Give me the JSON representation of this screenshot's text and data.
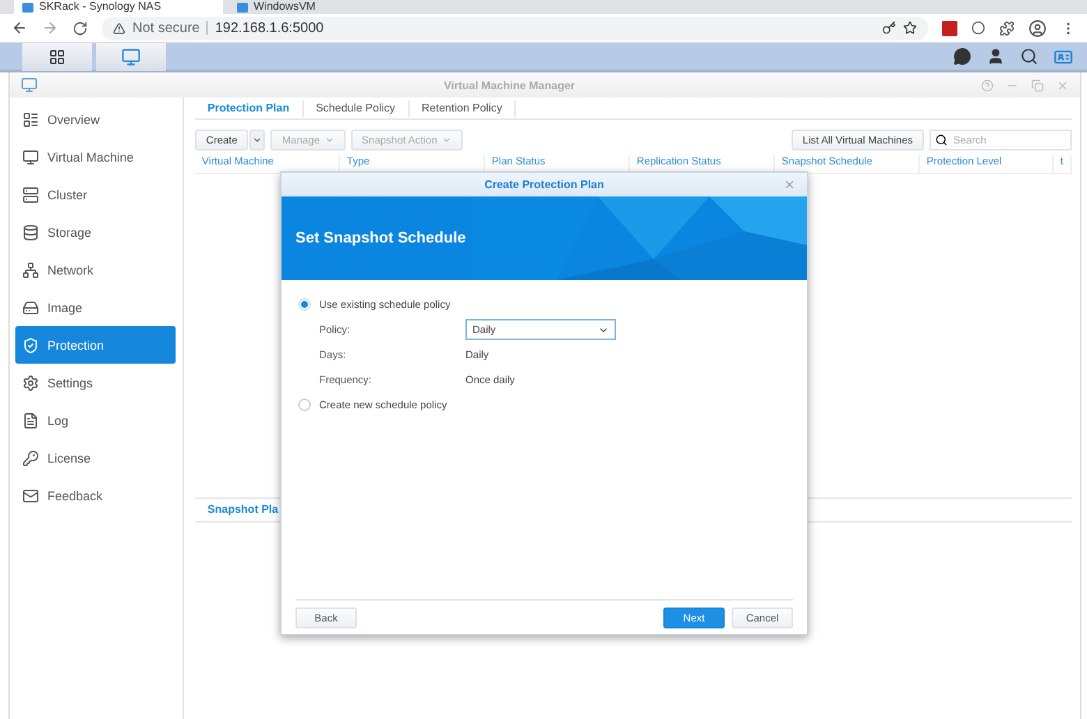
{
  "browser": {
    "tabs": [
      {
        "title": "SKRack - Synology NAS",
        "selected": true
      },
      {
        "title": "WindowsVM",
        "selected": false
      }
    ],
    "address": {
      "security": "Not secure",
      "url": "192.168.1.6:5000"
    }
  },
  "app": {
    "title": "Virtual Machine Manager",
    "sidebar": [
      {
        "label": "Overview",
        "selected": false
      },
      {
        "label": "Virtual Machine",
        "selected": false
      },
      {
        "label": "Cluster",
        "selected": false
      },
      {
        "label": "Storage",
        "selected": false
      },
      {
        "label": "Network",
        "selected": false
      },
      {
        "label": "Image",
        "selected": false
      },
      {
        "label": "Protection",
        "selected": true
      },
      {
        "label": "Settings",
        "selected": false
      },
      {
        "label": "Log",
        "selected": false
      },
      {
        "label": "License",
        "selected": false
      },
      {
        "label": "Feedback",
        "selected": false
      }
    ],
    "tabs": [
      {
        "label": "Protection Plan",
        "selected": true
      },
      {
        "label": "Schedule Policy",
        "selected": false
      },
      {
        "label": "Retention Policy",
        "selected": false
      }
    ],
    "toolbar": {
      "create": "Create",
      "buttons": [
        {
          "label": "Manage",
          "disabled": true
        },
        {
          "label": "Snapshot Action",
          "disabled": true
        }
      ],
      "list_all": "List All Virtual Machines",
      "search_placeholder": "Search"
    },
    "columns": [
      "Virtual Machine",
      "Type",
      "Plan Status",
      "Replication Status",
      "Snapshot Schedule",
      "Protection Level",
      "t"
    ],
    "bottom_tabs": [
      {
        "label": "Snapshot Pla",
        "selected": true
      }
    ]
  },
  "dialog": {
    "title": "Create Protection Plan",
    "heading": "Set Snapshot Schedule",
    "options": [
      {
        "label": "Use existing schedule policy",
        "selected": true
      },
      {
        "label": "Create new schedule policy",
        "selected": false
      }
    ],
    "fields": [
      {
        "label": "Policy:",
        "value": "Daily",
        "kind": "select"
      },
      {
        "label": "Days:",
        "value": "Daily",
        "kind": "text"
      },
      {
        "label": "Frequency:",
        "value": "Once daily",
        "kind": "text"
      }
    ],
    "buttons": [
      {
        "label": "Back",
        "kind": "default"
      },
      {
        "label": "Next",
        "kind": "primary"
      },
      {
        "label": "Cancel",
        "kind": "default"
      }
    ]
  }
}
